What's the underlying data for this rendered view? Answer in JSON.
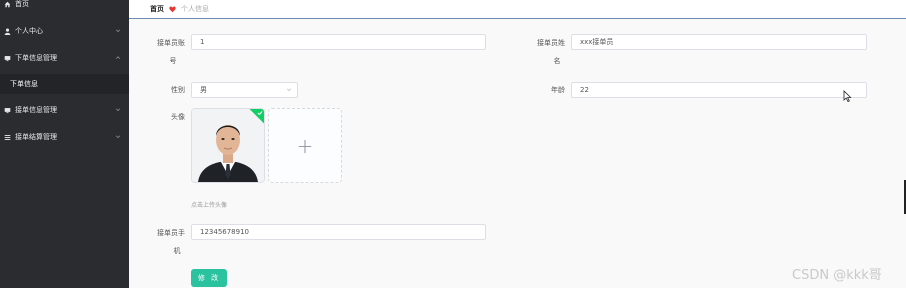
{
  "sidebar": {
    "items": [
      {
        "label": "首页",
        "icon": "home-icon"
      },
      {
        "label": "个人中心",
        "icon": "user-icon"
      },
      {
        "label": "下单信息管理",
        "icon": "monitor-icon"
      },
      {
        "label": "下单信息",
        "icon": ""
      },
      {
        "label": "接单信息管理",
        "icon": "monitor-icon"
      },
      {
        "label": "接单结算管理",
        "icon": "list-icon"
      }
    ]
  },
  "breadcrumb": {
    "home": "首页",
    "current": "个人信息"
  },
  "form": {
    "account_label_1": "接单员账",
    "account_label_2": "号",
    "account_value": "1",
    "name_label_1": "接单员姓",
    "name_label_2": "名",
    "name_value": "xxx接单员",
    "gender_label": "性别",
    "gender_value": "男",
    "age_label": "年龄",
    "age_value": "22",
    "avatar_label": "头像",
    "upload_plus": "+",
    "upload_hint": "点击上传头像",
    "phone_label_1": "接单员手",
    "phone_label_2": "机",
    "phone_value": "12345678910",
    "submit_label": "修 改"
  },
  "watermark": "CSDN @kkk哥",
  "colors": {
    "sidebar_bg": "#2b2c30",
    "accent_green": "#2bc2a0",
    "heart_red": "#e3372f"
  }
}
